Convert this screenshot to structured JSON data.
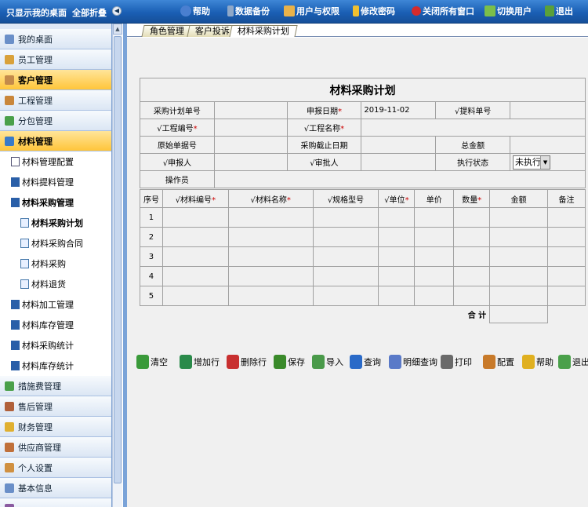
{
  "topbar": {
    "show_desktop": "只显示我的桌面",
    "collapse_all": "全部折叠",
    "menu": [
      {
        "label": "帮助",
        "icon": "help-icon"
      },
      {
        "label": "数据备份",
        "icon": "database-icon"
      },
      {
        "label": "用户与权限",
        "icon": "users-icon"
      },
      {
        "label": "修改密码",
        "icon": "key-icon"
      },
      {
        "label": "关闭所有窗口",
        "icon": "close-all-icon"
      },
      {
        "label": "切换用户",
        "icon": "switch-user-icon"
      },
      {
        "label": "退出",
        "icon": "exit-icon"
      }
    ]
  },
  "sidebar": {
    "items": [
      {
        "label": "我的桌面",
        "icon": "desktop-icon"
      },
      {
        "label": "员工管理",
        "icon": "employee-icon"
      },
      {
        "label": "客户管理",
        "icon": "customer-icon"
      },
      {
        "label": "工程管理",
        "icon": "project-icon"
      },
      {
        "label": "分包管理",
        "icon": "subcontract-icon"
      },
      {
        "label": "材料管理",
        "icon": "material-icon"
      }
    ],
    "material_sub": [
      {
        "label": "材料管理配置",
        "icon": "document-icon"
      },
      {
        "label": "材料提料管理",
        "icon": "folder-icon"
      },
      {
        "label": "材料采购管理",
        "icon": "folder-icon"
      }
    ],
    "purchase_sub": [
      {
        "label": "材料采购计划",
        "icon": "page-icon"
      },
      {
        "label": "材料采购合同",
        "icon": "page-icon"
      },
      {
        "label": "材料采购",
        "icon": "page-icon"
      },
      {
        "label": "材料退货",
        "icon": "page-icon"
      }
    ],
    "material_sub2": [
      {
        "label": "材料加工管理",
        "icon": "folder-icon"
      },
      {
        "label": "材料库存管理",
        "icon": "folder-icon"
      },
      {
        "label": "材料采购统计",
        "icon": "folder-icon"
      },
      {
        "label": "材料库存统计",
        "icon": "folder-icon"
      }
    ],
    "items2": [
      {
        "label": "措施费管理",
        "icon": "measure-icon"
      },
      {
        "label": "售后管理",
        "icon": "aftersale-icon"
      },
      {
        "label": "财务管理",
        "icon": "finance-icon"
      },
      {
        "label": "供应商管理",
        "icon": "supplier-icon"
      },
      {
        "label": "个人设置",
        "icon": "personal-icon"
      },
      {
        "label": "基本信息",
        "icon": "info-icon"
      }
    ]
  },
  "tabs": [
    "角色管理",
    "客户投诉",
    "材料采购计划"
  ],
  "form": {
    "title": "材料采购计划",
    "plan_no_label": "采购计划单号",
    "report_date_label": "申报日期",
    "report_date_value": "2019-11-02",
    "pick_no_label": "√提料单号",
    "project_no_label": "√工程编号",
    "project_name_label": "√工程名称",
    "orig_doc_label": "原始单据号",
    "deadline_label": "采购截止日期",
    "total_label": "总金额",
    "reporter_label": "√申报人",
    "approver_label": "√审批人",
    "exec_status_label": "执行状态",
    "exec_status_value": "未执行",
    "operator_label": "操作员",
    "required_mark": "*",
    "dropdown_arrow": "▼"
  },
  "grid": {
    "headers": [
      "序号",
      "√材料编号",
      "√材料名称",
      "√规格型号",
      "√单位",
      "单价",
      "数量",
      "金额",
      "备注"
    ],
    "required": [
      false,
      true,
      true,
      false,
      true,
      false,
      true,
      false,
      false
    ],
    "rows": [
      "1",
      "2",
      "3",
      "4",
      "5"
    ],
    "sum_label": "合 计"
  },
  "toolbar": [
    {
      "label": "清空",
      "icon": "clear-icon"
    },
    {
      "label": "增加行",
      "icon": "add-row-icon"
    },
    {
      "label": "删除行",
      "icon": "delete-row-icon"
    },
    {
      "label": "保存",
      "icon": "save-icon"
    },
    {
      "label": "导入",
      "icon": "import-icon"
    },
    {
      "label": "查询",
      "icon": "search-icon"
    },
    {
      "label": "明细查询",
      "icon": "detail-search-icon"
    },
    {
      "label": "打印",
      "icon": "print-icon"
    },
    {
      "label": "配置",
      "icon": "config-icon"
    },
    {
      "label": "帮助",
      "icon": "help-icon"
    },
    {
      "label": "退出",
      "icon": "exit-icon"
    }
  ]
}
